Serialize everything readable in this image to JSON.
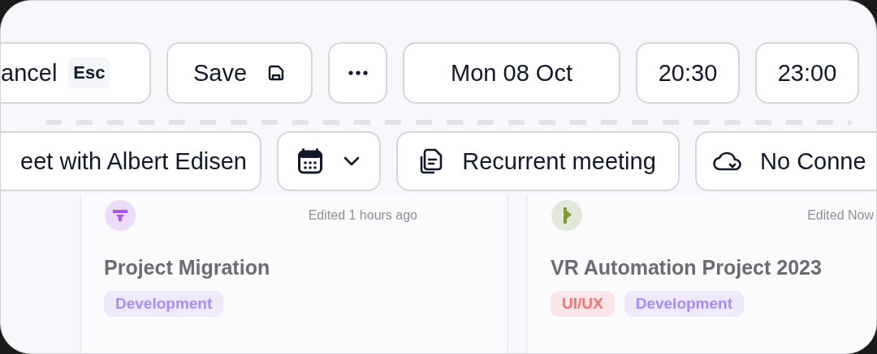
{
  "actions": {
    "cancel": {
      "label": "ancel",
      "shortcut": "Esc"
    },
    "save": {
      "label": "Save"
    }
  },
  "date": "Mon 08 Oct",
  "start_time": "20:30",
  "end_time": "23:00",
  "event": {
    "title": "eet with Albert Edisen",
    "recurrence": "Recurrent meeting",
    "sync_status": "No Conne"
  },
  "cards": [
    {
      "kind": "funnel",
      "color": "#a855f7",
      "edited": "Edited 1 hours ago",
      "title": "Project Migration",
      "tags": [
        {
          "label": "Development",
          "color": "#a78bfa"
        }
      ]
    },
    {
      "kind": "flag",
      "color": "#7c9a3a",
      "edited": "Edited Now",
      "title": "VR Automation Project 2023",
      "tags": [
        {
          "label": "UI/UX",
          "color": "#f87171"
        },
        {
          "label": "Development",
          "color": "#a78bfa"
        }
      ]
    }
  ]
}
